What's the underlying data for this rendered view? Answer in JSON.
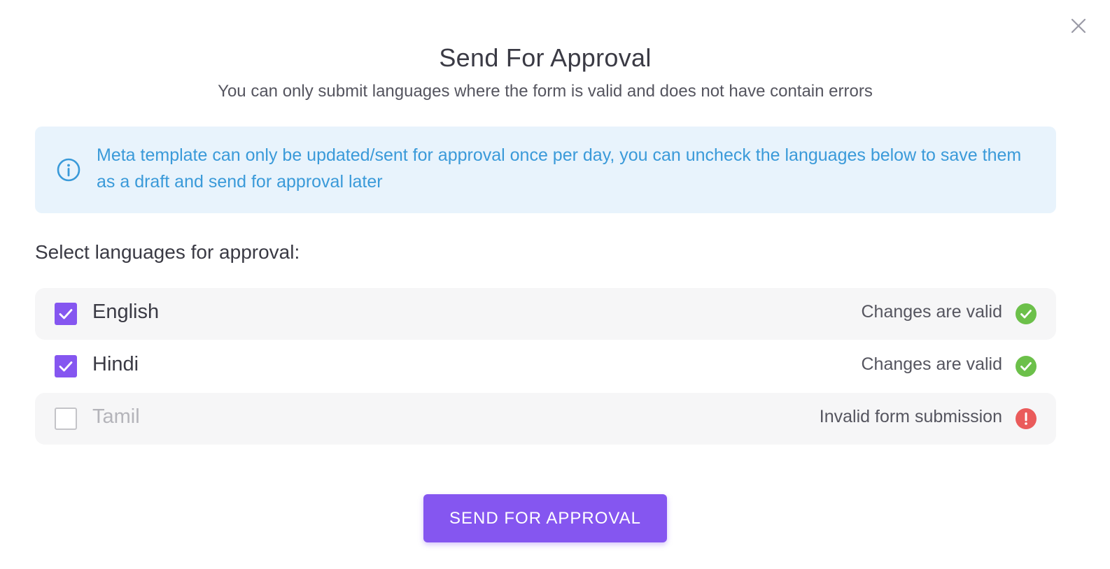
{
  "dialog": {
    "title": "Send For Approval",
    "subtitle": "You can only submit languages where the form is valid and does not have contain errors",
    "close_icon": "close-icon"
  },
  "info_banner": {
    "icon": "info-icon",
    "text": "Meta template can only be updated/sent for approval once per day, you can uncheck the languages below to save them as a draft and send for approval later",
    "color": "#3a9ad9",
    "background": "#e8f3fc"
  },
  "languages_section": {
    "label": "Select languages for approval:",
    "items": [
      {
        "name": "English",
        "checked": true,
        "status": "Changes are valid",
        "status_icon": "check-circle-icon",
        "status_color": "#6cc04a"
      },
      {
        "name": "Hindi",
        "checked": true,
        "status": "Changes are valid",
        "status_icon": "check-circle-icon",
        "status_color": "#6cc04a"
      },
      {
        "name": "Tamil",
        "checked": false,
        "status": "Invalid form submission",
        "status_icon": "error-circle-icon",
        "status_color": "#ea5b5b"
      }
    ]
  },
  "actions": {
    "submit_label": "SEND FOR APPROVAL",
    "accent": "#8556f0"
  }
}
